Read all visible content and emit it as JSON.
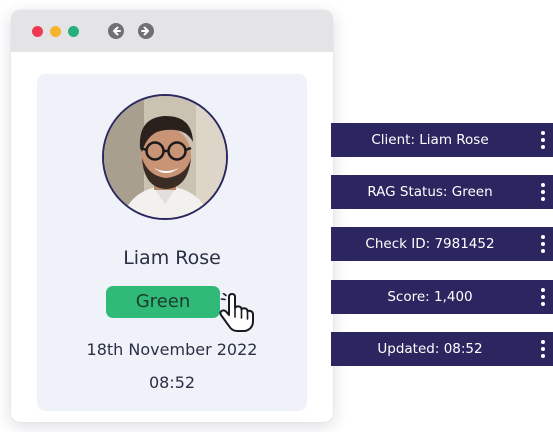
{
  "window": {
    "controls": [
      "close",
      "minimize",
      "maximize"
    ],
    "nav": {
      "back_icon": "back-arrow-icon",
      "forward_icon": "forward-arrow-icon"
    }
  },
  "profile": {
    "name": "Liam Rose",
    "status": "Green",
    "date": "18th November 2022",
    "time": "08:52",
    "status_color": "#2fba78"
  },
  "info_bars": [
    {
      "label": "Client: Liam Rose",
      "menu_icon": "kebab-menu-icon"
    },
    {
      "label": "RAG Status: Green",
      "menu_icon": "kebab-menu-icon"
    },
    {
      "label": "Check ID: 7981452",
      "menu_icon": "kebab-menu-icon"
    },
    {
      "label": "Score: 1,400",
      "menu_icon": "kebab-menu-icon"
    },
    {
      "label": "Updated: 08:52",
      "menu_icon": "kebab-menu-icon"
    }
  ],
  "colors": {
    "bar": "#2c2660",
    "card": "#eff2f8",
    "dot_red": "#ee3b53",
    "dot_yellow": "#f5b42b",
    "dot_green": "#27b07b"
  }
}
